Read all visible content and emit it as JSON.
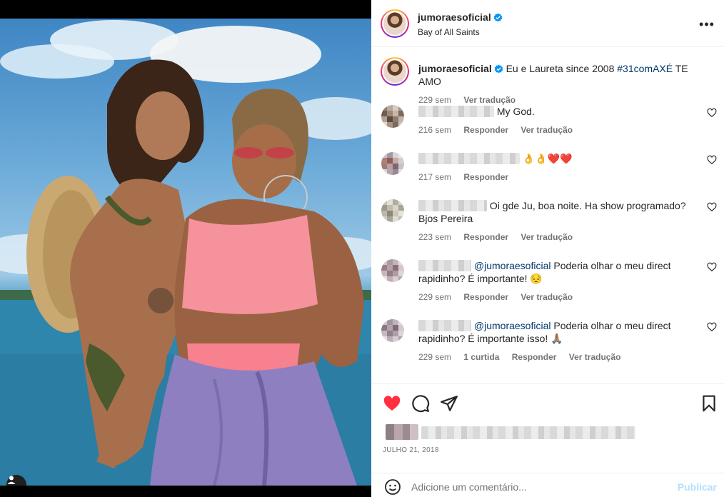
{
  "post": {
    "author": "jumoraesoficial",
    "location": "Bay of All Saints",
    "caption_text": "Eu e Laureta since 2008 ",
    "caption_hashtag": "#31comAXÉ",
    "caption_end": " TE AMO",
    "caption_time": "229 sem",
    "caption_translate": "Ver tradução",
    "date": "JULHO 21, 2018"
  },
  "comments": [
    {
      "text": "My God.",
      "time": "216 sem",
      "reply": "Responder",
      "translate": "Ver tradução"
    },
    {
      "text": "👌👌❤️❤️",
      "time": "217 sem",
      "reply": "Responder"
    },
    {
      "prefix": "joumperd0022",
      "text": "Oi gde Ju, boa noite. Ha show programado? Bjos Pereira",
      "time": "223 sem",
      "reply": "Responder",
      "translate": "Ver tradução"
    },
    {
      "mention": "@jumoraesoficial",
      "text": " Poderia olhar o meu direct rapidinho? É importante! 😔",
      "time": "229 sem",
      "reply": "Responder",
      "translate": "Ver tradução"
    },
    {
      "mention": "@jumoraesoficial",
      "text": " Poderia olhar o meu direct rapidinho? É importante isso! 🙏🏽",
      "time": "229 sem",
      "likes": "1 curtida",
      "reply": "Responder",
      "translate": "Ver tradução"
    }
  ],
  "composer": {
    "placeholder": "Adicione um comentário...",
    "publish_label": "Publicar"
  },
  "colors": {
    "like_red": "#ff3040",
    "verified_blue": "#0095f6",
    "link_blue": "#00376b",
    "publish_disabled": "#b2dffc"
  }
}
